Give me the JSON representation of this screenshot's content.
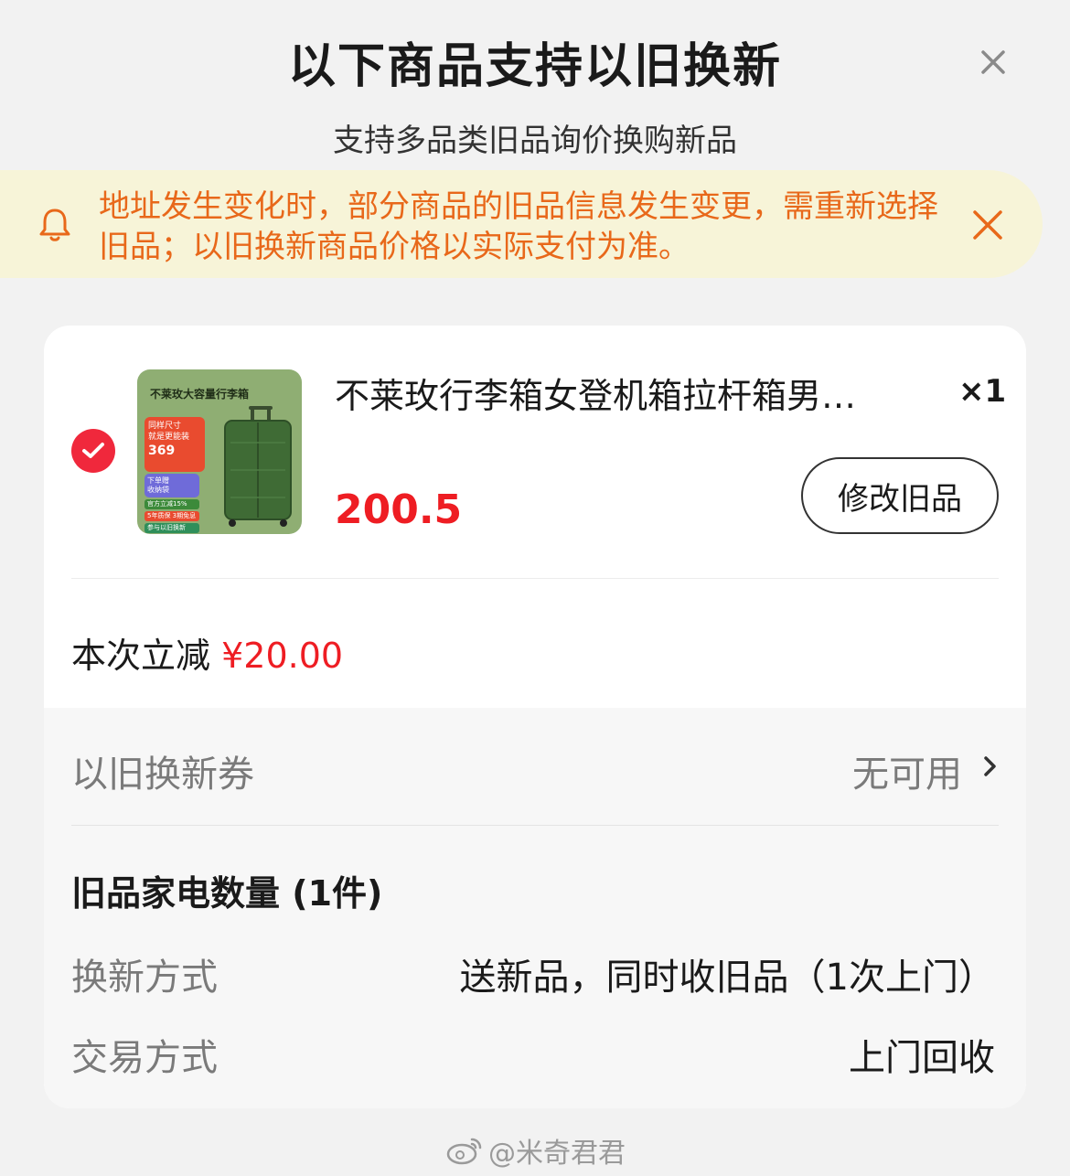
{
  "header": {
    "title": "以下商品支持以旧换新",
    "subtitle": "支持多品类旧品询价换购新品"
  },
  "notice": {
    "text": "地址发生变化时，部分商品的旧品信息发生变更，需重新选择旧品；以旧换新商品价格以实际支付为准。"
  },
  "product": {
    "selected": true,
    "title": "不莱玫行李箱女登机箱拉杆箱男…",
    "quantity": "×1",
    "price": "200.5",
    "modify_label": "修改旧品",
    "thumbnail": {
      "headline": "不莱玫大容量行李箱",
      "tag_line1": "同样尺寸",
      "tag_line2": "就是更能装",
      "tag_price": "369",
      "tag2_line1": "下单赠",
      "tag2_line2": "收纳袋",
      "pill1": "官方立减15%",
      "pill2": "5年质保 3期免息",
      "pill3": "参与以旧换新"
    }
  },
  "discount": {
    "label": "本次立减",
    "amount": "¥20.00"
  },
  "coupon": {
    "label": "以旧换新券",
    "value": "无可用"
  },
  "old_items": {
    "count_label": "旧品家电数量 (1件)",
    "rows": [
      {
        "label": "换新方式",
        "value": "送新品，同时收旧品（1次上门）"
      },
      {
        "label": "交易方式",
        "value": "上门回收"
      }
    ]
  },
  "watermark": {
    "text": "@米奇君君"
  },
  "colors": {
    "accent_red": "#ee1d23",
    "notice_bg": "#f7f4d8",
    "notice_text": "#e8681a",
    "check_red": "#f0283c"
  }
}
